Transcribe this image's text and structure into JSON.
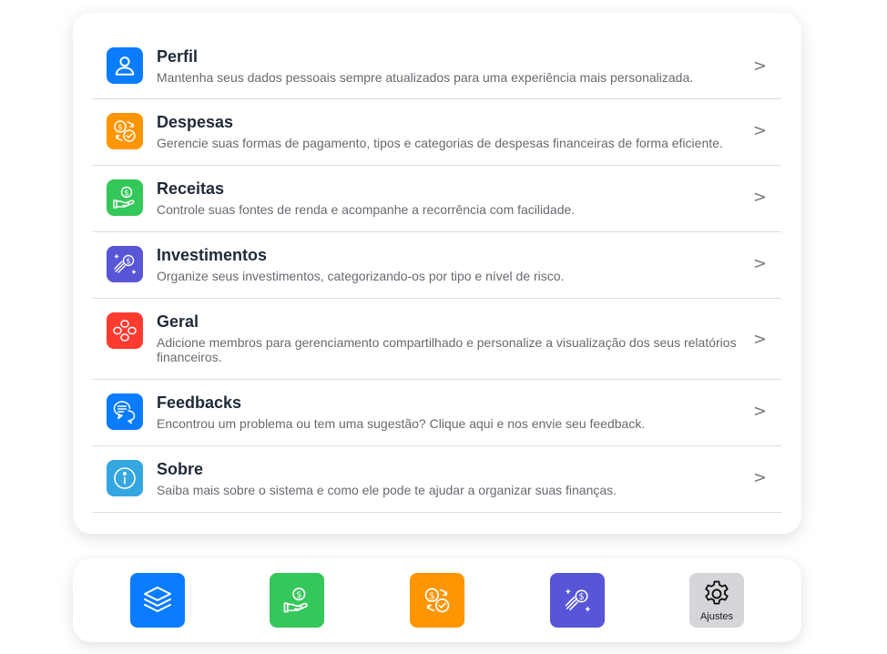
{
  "settings_list": {
    "items": [
      {
        "title": "Perfil",
        "description": "Mantenha seus dados pessoais sempre atualizados para uma experiência mais personalizada.",
        "icon": "user-icon",
        "color": "#0a7cff"
      },
      {
        "title": "Despesas",
        "description": "Gerencie suas formas de pagamento, tipos e categorias de despesas financeiras de forma eficiente.",
        "icon": "expenses-icon",
        "color": "#ff9500"
      },
      {
        "title": "Receitas",
        "description": "Controle suas fontes de renda e acompanhe a recorrência com facilidade.",
        "icon": "income-icon",
        "color": "#34c759"
      },
      {
        "title": "Investimentos",
        "description": "Organize seus investimentos, categorizando-os por tipo e nível de risco.",
        "icon": "investments-icon",
        "color": "#5856d6"
      },
      {
        "title": "Geral",
        "description": "Adicione membros para gerenciamento compartilhado e personalize a visualização dos seus relatórios financeiros.",
        "icon": "general-icon",
        "color": "#ff3b30"
      },
      {
        "title": "Feedbacks",
        "description": "Encontrou um problema ou tem uma sugestão? Clique aqui e nos envie seu feedback.",
        "icon": "chat-icon",
        "color": "#0a7cff"
      },
      {
        "title": "Sobre",
        "description": "Saiba mais sobre o sistema e como ele pode te ajudar a organizar suas finanças.",
        "icon": "info-icon",
        "color": "#34a6e0"
      }
    ],
    "chevron": ">"
  },
  "bottom_nav": {
    "items": [
      {
        "icon": "layers-icon",
        "color": "#0a7cff",
        "label": ""
      },
      {
        "icon": "income-icon",
        "color": "#34c759",
        "label": ""
      },
      {
        "icon": "expenses-icon",
        "color": "#ff9500",
        "label": ""
      },
      {
        "icon": "investments-icon",
        "color": "#5856d6",
        "label": ""
      },
      {
        "icon": "gear-icon",
        "color": "#d6d6da",
        "label": "Ajustes"
      }
    ]
  }
}
